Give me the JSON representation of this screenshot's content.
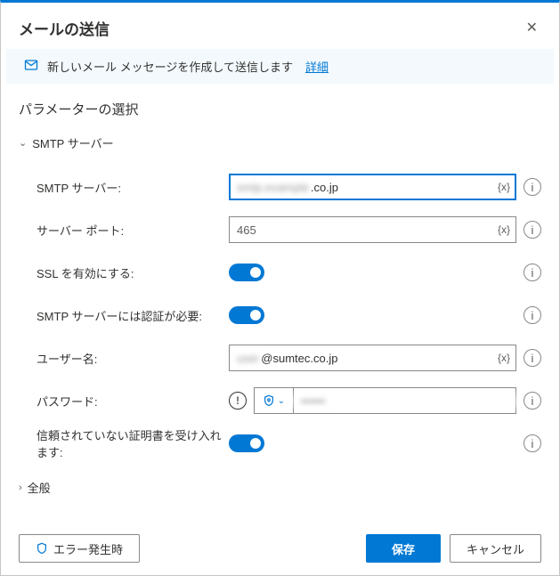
{
  "dialog": {
    "title": "メールの送信",
    "info_text": "新しいメール メッセージを作成して送信します",
    "info_link": "詳細"
  },
  "sections": {
    "params_title": "パラメーターの選択",
    "smtp_group": "SMTP サーバー",
    "general_group": "全般"
  },
  "fields": {
    "smtp_server": {
      "label": "SMTP サーバー:",
      "value_hidden": "smtp.example",
      "value_suffix": ".co.jp"
    },
    "server_port": {
      "label": "サーバー ポート:",
      "value": "465"
    },
    "ssl_enable": {
      "label": "SSL を有効にする:"
    },
    "smtp_auth": {
      "label": "SMTP サーバーには認証が必要:"
    },
    "username": {
      "label": "ユーザー名:",
      "value_hidden": "user",
      "value_suffix": "@sumtec.co.jp"
    },
    "password": {
      "label": "パスワード:",
      "masked": "••••••"
    },
    "trust_cert": {
      "label": "信頼されていない証明書を受け入れます:"
    }
  },
  "fx": "{x}",
  "footer": {
    "on_error": "エラー発生時",
    "save": "保存",
    "cancel": "キャンセル"
  }
}
